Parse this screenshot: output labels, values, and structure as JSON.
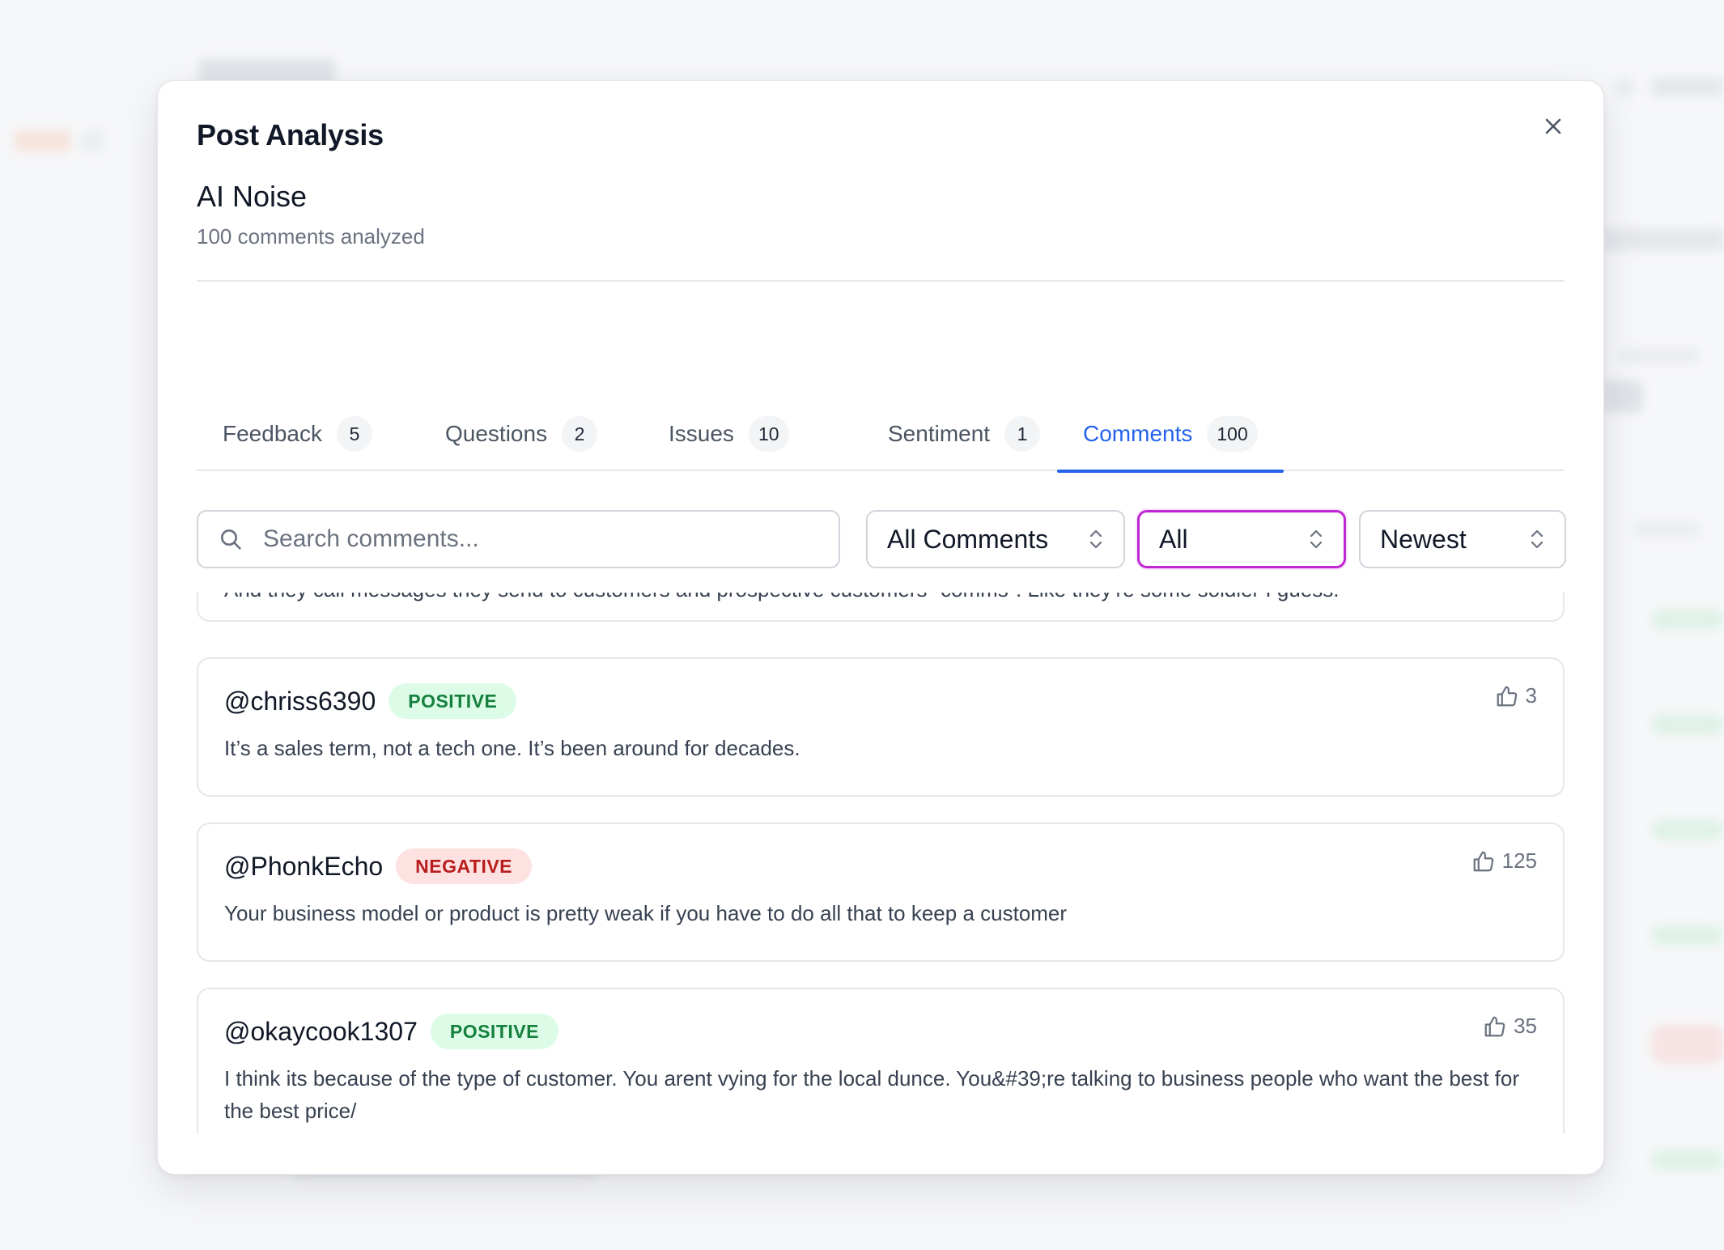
{
  "modal": {
    "title": "Post Analysis",
    "post_title": "AI Noise",
    "post_subtitle": "100 comments analyzed"
  },
  "tabs": [
    {
      "label": "Feedback",
      "count": "5",
      "active": false
    },
    {
      "label": "Questions",
      "count": "2",
      "active": false
    },
    {
      "label": "Issues",
      "count": "10",
      "active": false
    },
    {
      "label": "Sentiment",
      "count": "1",
      "active": false
    },
    {
      "label": "Comments",
      "count": "100",
      "active": true
    }
  ],
  "filters": {
    "search_placeholder": "Search comments...",
    "type_value": "All Comments",
    "sentiment_value": "All",
    "sort_value": "Newest"
  },
  "comments": [
    {
      "author": "",
      "sentiment": "",
      "likes": "",
      "text": "And they call messages they send to customers and prospective customers \"comms\". Like they're some soldier I guess."
    },
    {
      "author": "@chriss6390",
      "sentiment": "POSITIVE",
      "likes": "3",
      "text": "It’s a sales term, not a tech one. It’s been around for decades."
    },
    {
      "author": "@PhonkEcho",
      "sentiment": "NEGATIVE",
      "likes": "125",
      "text": "Your business model or product is pretty weak if you have to do all that to keep a customer"
    },
    {
      "author": "@okaycook1307",
      "sentiment": "POSITIVE",
      "likes": "35",
      "text": "I think its because of the type of customer. You arent vying for the local dunce. You&#39;re talking to business people who want the best for the best price/"
    }
  ],
  "colors": {
    "accent": "#2563eb",
    "positive_bg": "#dcfce7",
    "positive_text": "#15803d",
    "negative_bg": "#fee2e2",
    "negative_text": "#b91c1c",
    "focus_ring": "#c026d3"
  },
  "icons": {
    "close": "close-icon",
    "search": "search-icon",
    "select": "chevron-up-down-icon",
    "likes": "thumbs-up-icon"
  }
}
